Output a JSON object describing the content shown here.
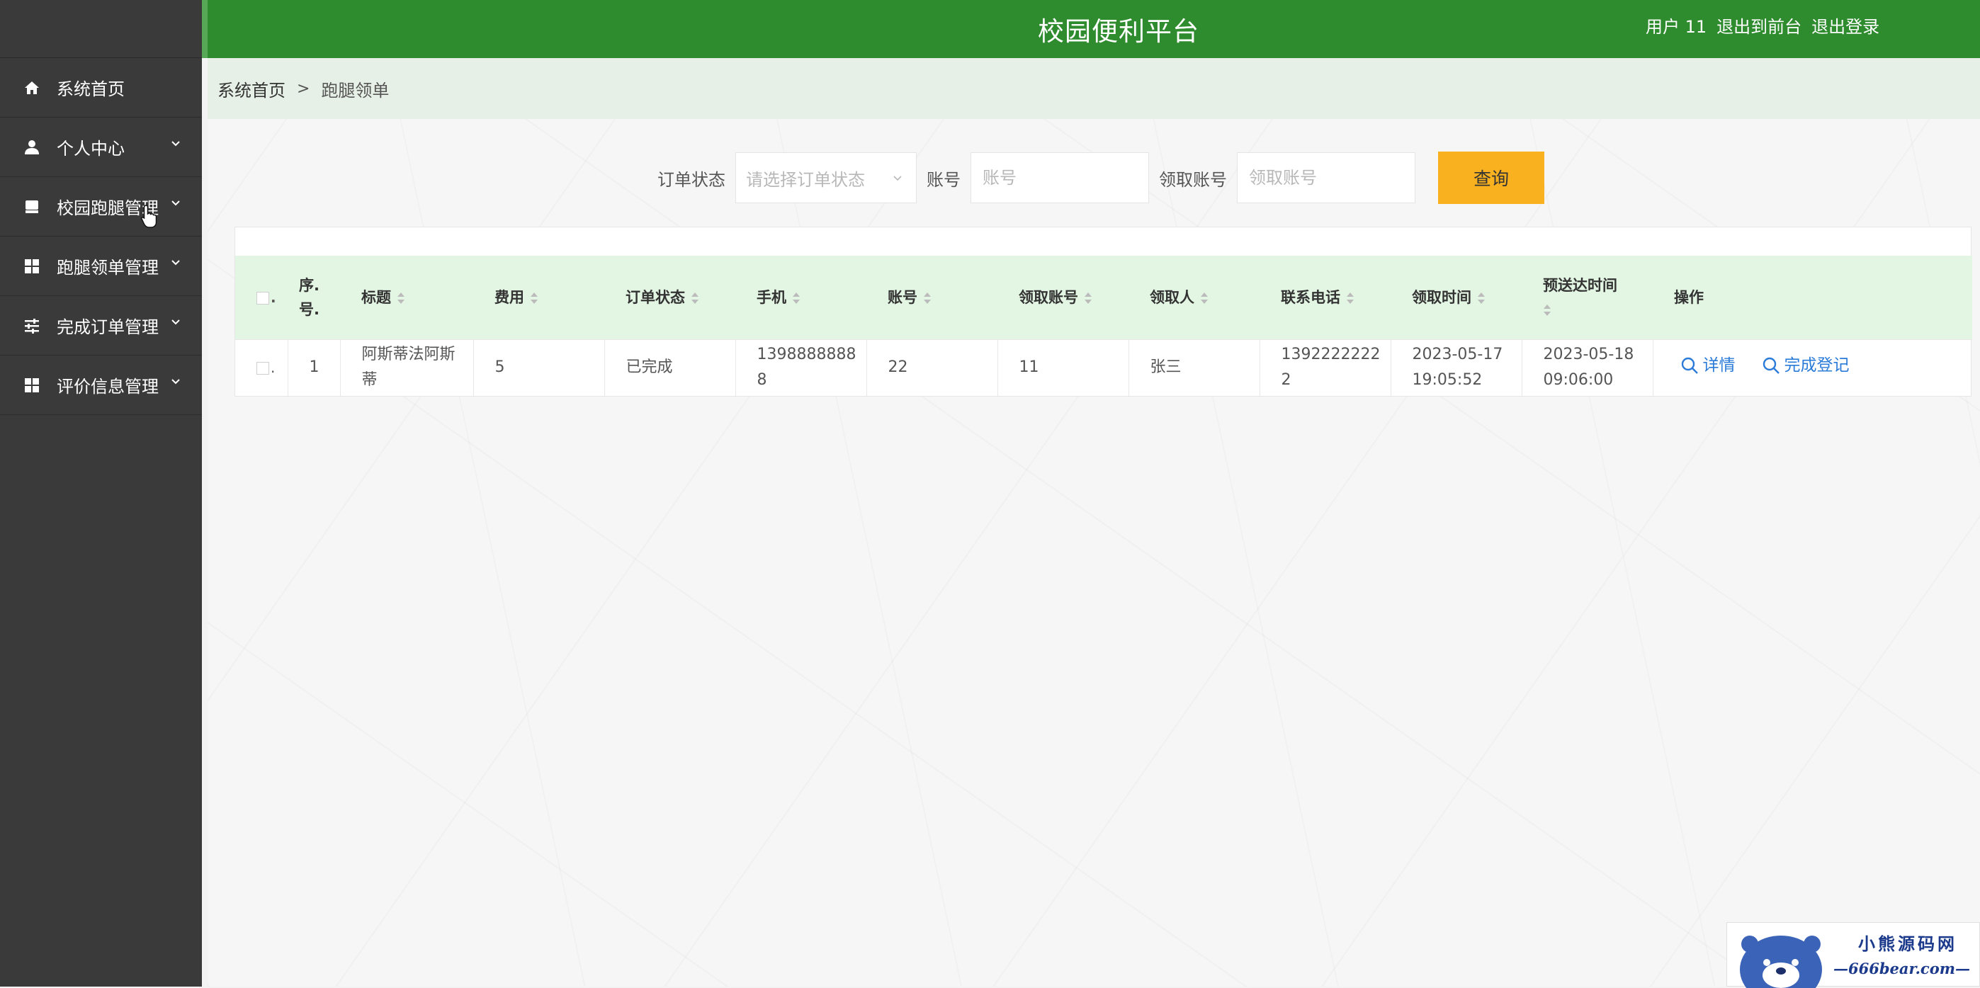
{
  "header": {
    "title": "校园便利平台",
    "user_label": "用户 11",
    "to_frontend": "退出到前台",
    "logout": "退出登录",
    "bg_color": "#2e8b2e"
  },
  "sidebar": {
    "items": [
      {
        "label": "系统首页",
        "icon": "home-icon",
        "has_children": false
      },
      {
        "label": "个人中心",
        "icon": "user-icon",
        "has_children": true
      },
      {
        "label": "校园跑腿管理",
        "icon": "box-icon",
        "has_children": true
      },
      {
        "label": "跑腿领单管理",
        "icon": "grid-icon",
        "has_children": true
      },
      {
        "label": "完成订单管理",
        "icon": "sliders-icon",
        "has_children": true
      },
      {
        "label": "评价信息管理",
        "icon": "grid-icon",
        "has_children": true
      }
    ]
  },
  "breadcrumb": {
    "home": "系统首页",
    "separator": ">",
    "current": "跑腿领单"
  },
  "search": {
    "order_status_label": "订单状态",
    "order_status_placeholder": "请选择订单状态",
    "account_label": "账号",
    "account_placeholder": "账号",
    "receiver_label": "领取账号",
    "receiver_placeholder": "领取账号",
    "query_button": "查询",
    "query_button_color": "#f9b11f"
  },
  "table": {
    "columns": {
      "dot": ".",
      "index": "序.号.",
      "title": "标题",
      "fee": "费用",
      "status": "订单状态",
      "phone": "手机",
      "account": "账号",
      "receiver_account": "领取账号",
      "receiver": "领取人",
      "contact": "联系电话",
      "receive_time": "领取时间",
      "expected_time": "预送达时间",
      "actions": "操作"
    },
    "rows": [
      {
        "dot": ".",
        "index": "1",
        "title": "阿斯蒂法阿斯蒂",
        "fee": "5",
        "status": "已完成",
        "phone": "13988888888",
        "account": "22",
        "receiver_account": "11",
        "receiver": "张三",
        "contact": "13922222222",
        "receive_time": "2023-05-17 19:05:52",
        "expected_time": "2023-05-18 09:06:00",
        "detail_label": "详情",
        "complete_label": "完成登记"
      }
    ],
    "header_bg": "#e3f5e3",
    "link_color": "#2b7bd8"
  },
  "watermark": {
    "line1": "小熊源码网",
    "line2": "—666bear.com—"
  }
}
